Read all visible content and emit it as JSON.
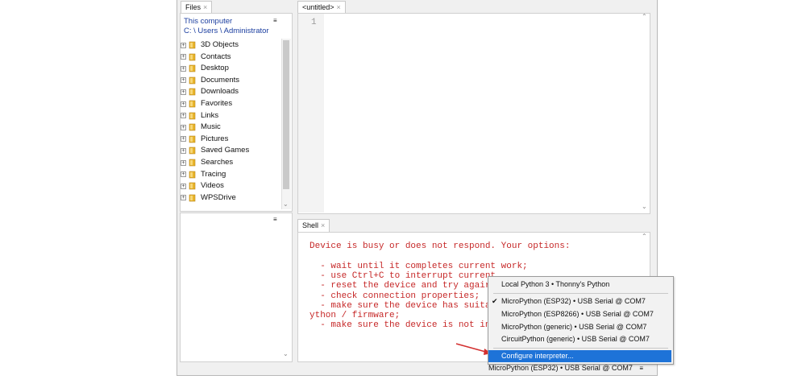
{
  "files_tab": {
    "label": "Files",
    "close": "×"
  },
  "editor_tab": {
    "label": "<untitled>",
    "close": "×"
  },
  "shell_tab": {
    "label": "Shell",
    "close": "×"
  },
  "files_panel": {
    "location_title": "This computer",
    "path": "C: \\ Users \\ Administrator",
    "menu_glyph": "≡",
    "items": [
      "3D Objects",
      "Contacts",
      "Desktop",
      "Documents",
      "Downloads",
      "Favorites",
      "Links",
      "Music",
      "Pictures",
      "Saved Games",
      "Searches",
      "Tracing",
      "Videos",
      "WPSDrive"
    ]
  },
  "lower_panel": {
    "menu_glyph": "≡"
  },
  "editor": {
    "line_number": "1"
  },
  "shell": {
    "lines": [
      "Device is busy or does not respond. Your options:",
      "",
      "  - wait until it completes current work;",
      "  - use Ctrl+C to interrupt current",
      "  - reset the device and try agair",
      "  - check connection properties;",
      "  - make sure the device has suita",
      "ython / firmware;",
      "  - make sure the device is not in"
    ]
  },
  "interpreter_menu": {
    "items": [
      {
        "label": "Local Python 3  •  Thonny's Python",
        "checked": false
      },
      {
        "label": "MicroPython (ESP32)  •  USB Serial @ COM7",
        "checked": true
      },
      {
        "label": "MicroPython (ESP8266)  •  USB Serial @ COM7",
        "checked": false
      },
      {
        "label": "MicroPython (generic)  •  USB Serial @ COM7",
        "checked": false
      },
      {
        "label": "CircuitPython (generic)  •  USB Serial @ COM7",
        "checked": false
      }
    ],
    "check_glyph": "✔",
    "configure_label": "Configure interpreter..."
  },
  "status_bar": {
    "interpreter": "MicroPython (ESP32)  •  USB Serial @ COM7",
    "menu_glyph": "≡"
  },
  "colors": {
    "accent": "#1e73d8",
    "shell_text": "#c62828",
    "folder": "#e8b42a",
    "arrow": "#d32f2f"
  }
}
